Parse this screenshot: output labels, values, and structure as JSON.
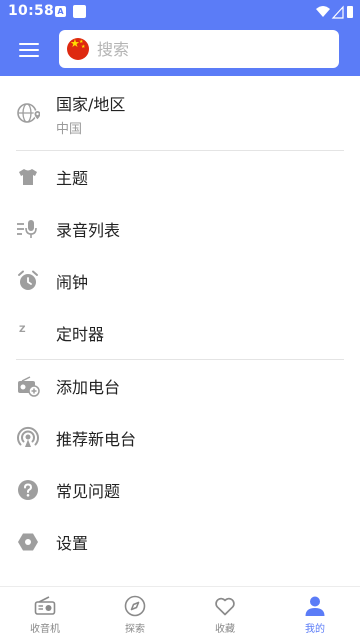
{
  "status_bar": {
    "time": "10:58"
  },
  "search": {
    "placeholder": "搜索"
  },
  "menu": {
    "region": {
      "label": "国家/地区",
      "value": "中国"
    },
    "theme": "主题",
    "recordings": "录音列表",
    "alarm": "闹钟",
    "timer": "定时器",
    "add_station": "添加电台",
    "recommend_station": "推荐新电台",
    "faq": "常见问题",
    "settings": "设置"
  },
  "bottom_nav": {
    "items": [
      {
        "label": "收音机",
        "icon": "radio-icon"
      },
      {
        "label": "探索",
        "icon": "compass-icon"
      },
      {
        "label": "收藏",
        "icon": "heart-icon"
      },
      {
        "label": "我的",
        "icon": "person-icon"
      }
    ],
    "active_index": 3
  },
  "colors": {
    "accent": "#5b7cf7",
    "icon_gray": "#9e9e9e",
    "text": "#222222",
    "subtext": "#9a9a9a"
  }
}
